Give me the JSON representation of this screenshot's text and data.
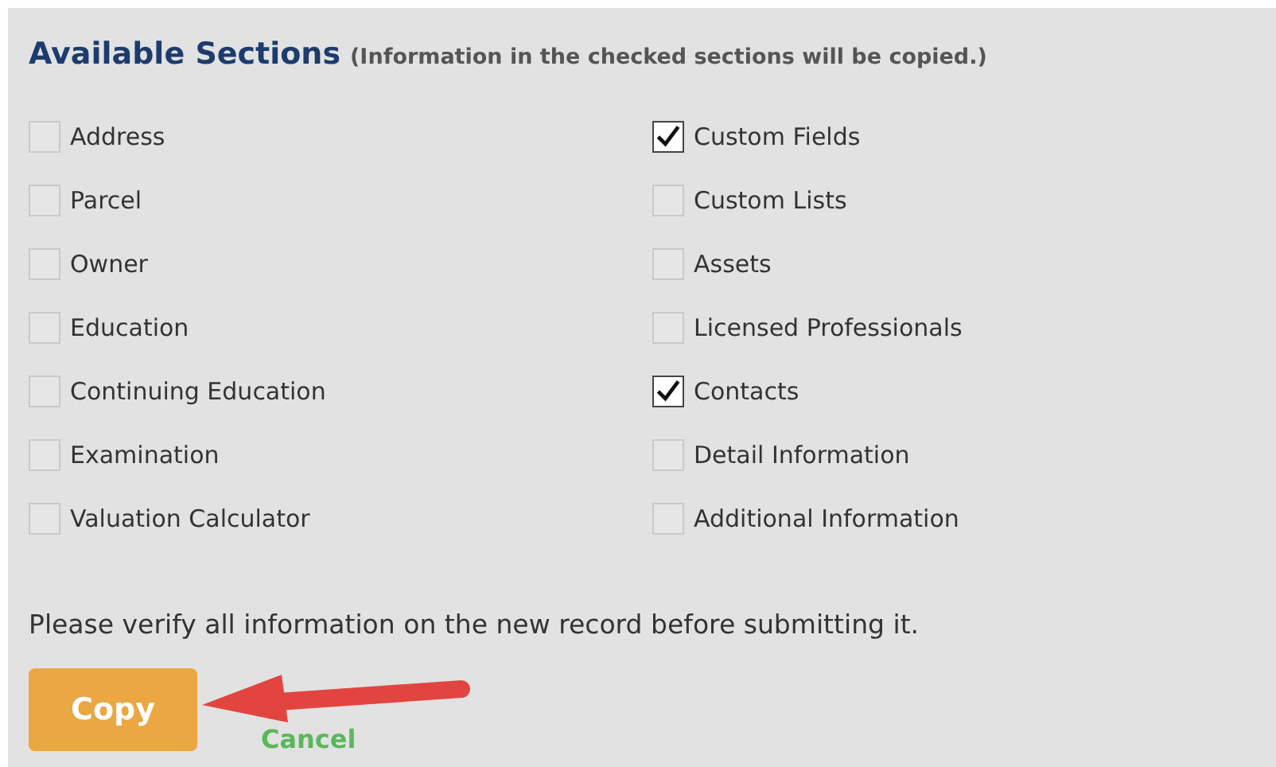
{
  "heading": {
    "title": "Available Sections",
    "note": "(Information in the checked sections will be copied.)"
  },
  "columns": [
    [
      {
        "label": "Address",
        "checked": false
      },
      {
        "label": "Parcel",
        "checked": false
      },
      {
        "label": "Owner",
        "checked": false
      },
      {
        "label": "Education",
        "checked": false
      },
      {
        "label": "Continuing Education",
        "checked": false
      },
      {
        "label": "Examination",
        "checked": false
      },
      {
        "label": "Valuation Calculator",
        "checked": false
      }
    ],
    [
      {
        "label": "Custom Fields",
        "checked": true
      },
      {
        "label": "Custom Lists",
        "checked": false
      },
      {
        "label": "Assets",
        "checked": false
      },
      {
        "label": "Licensed Professionals",
        "checked": false
      },
      {
        "label": "Contacts",
        "checked": true
      },
      {
        "label": "Detail Information",
        "checked": false
      },
      {
        "label": "Additional Information",
        "checked": false
      }
    ]
  ],
  "notice": "Please verify all information on the new record before submitting it.",
  "copy_button": "Copy",
  "cancel_link": "Cancel"
}
